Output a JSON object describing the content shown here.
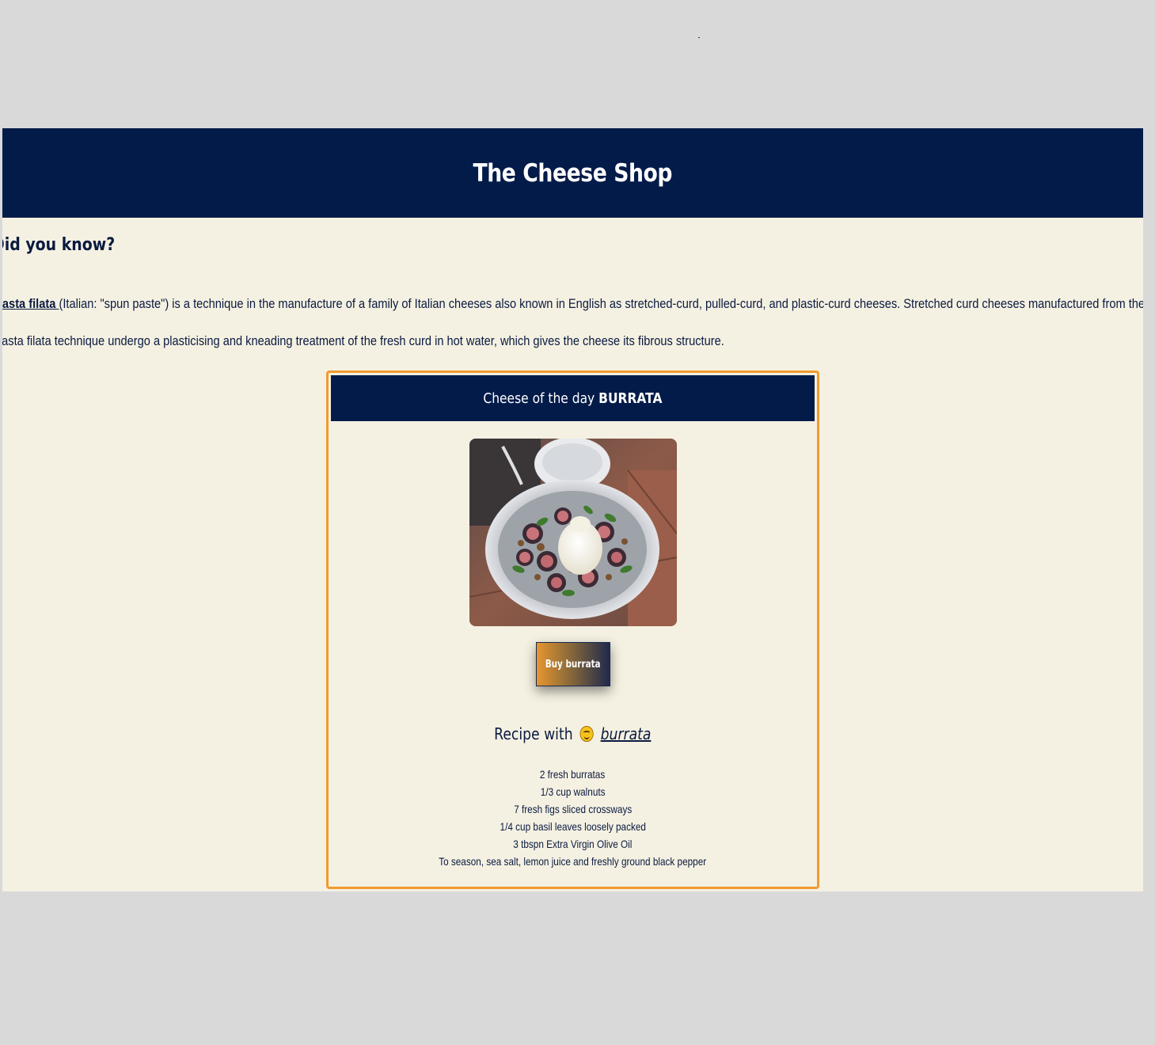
{
  "header": {
    "title": "The Cheese Shop"
  },
  "fact": {
    "heading": "Did you know?",
    "link_text": "pasta filata ",
    "body": "(Italian: \"spun paste\") is a technique in the manufacture of a family of Italian cheeses also known in English as stretched-curd, pulled-curd, and plastic-curd cheeses. Stretched curd cheeses manufactured from the pasta filata technique undergo a plasticising and kneading treatment of the fresh curd in hot water, which gives the cheese its fibrous structure."
  },
  "card": {
    "title_prefix": "Cheese of the day",
    "cheese_name": "BURRATA",
    "buy_label": "Buy burrata",
    "recipe_prefix": "Recipe with",
    "recipe_link": "burrata",
    "ingredients": [
      "2 fresh burratas",
      "1/3 cup walnuts",
      "7 fresh figs sliced crossways",
      "1/4 cup basil leaves loosely packed",
      "3 tbspn Extra Virgin Olive Oil",
      "To season, sea salt, lemon juice and freshly ground black pepper"
    ]
  },
  "colors": {
    "navy": "#031b49",
    "cream": "#f5f1e2",
    "accent": "#f29a2e",
    "backdrop": "#d9d9d9"
  },
  "icons": {
    "recipe_emoji": "yum-face-emoji-icon"
  }
}
